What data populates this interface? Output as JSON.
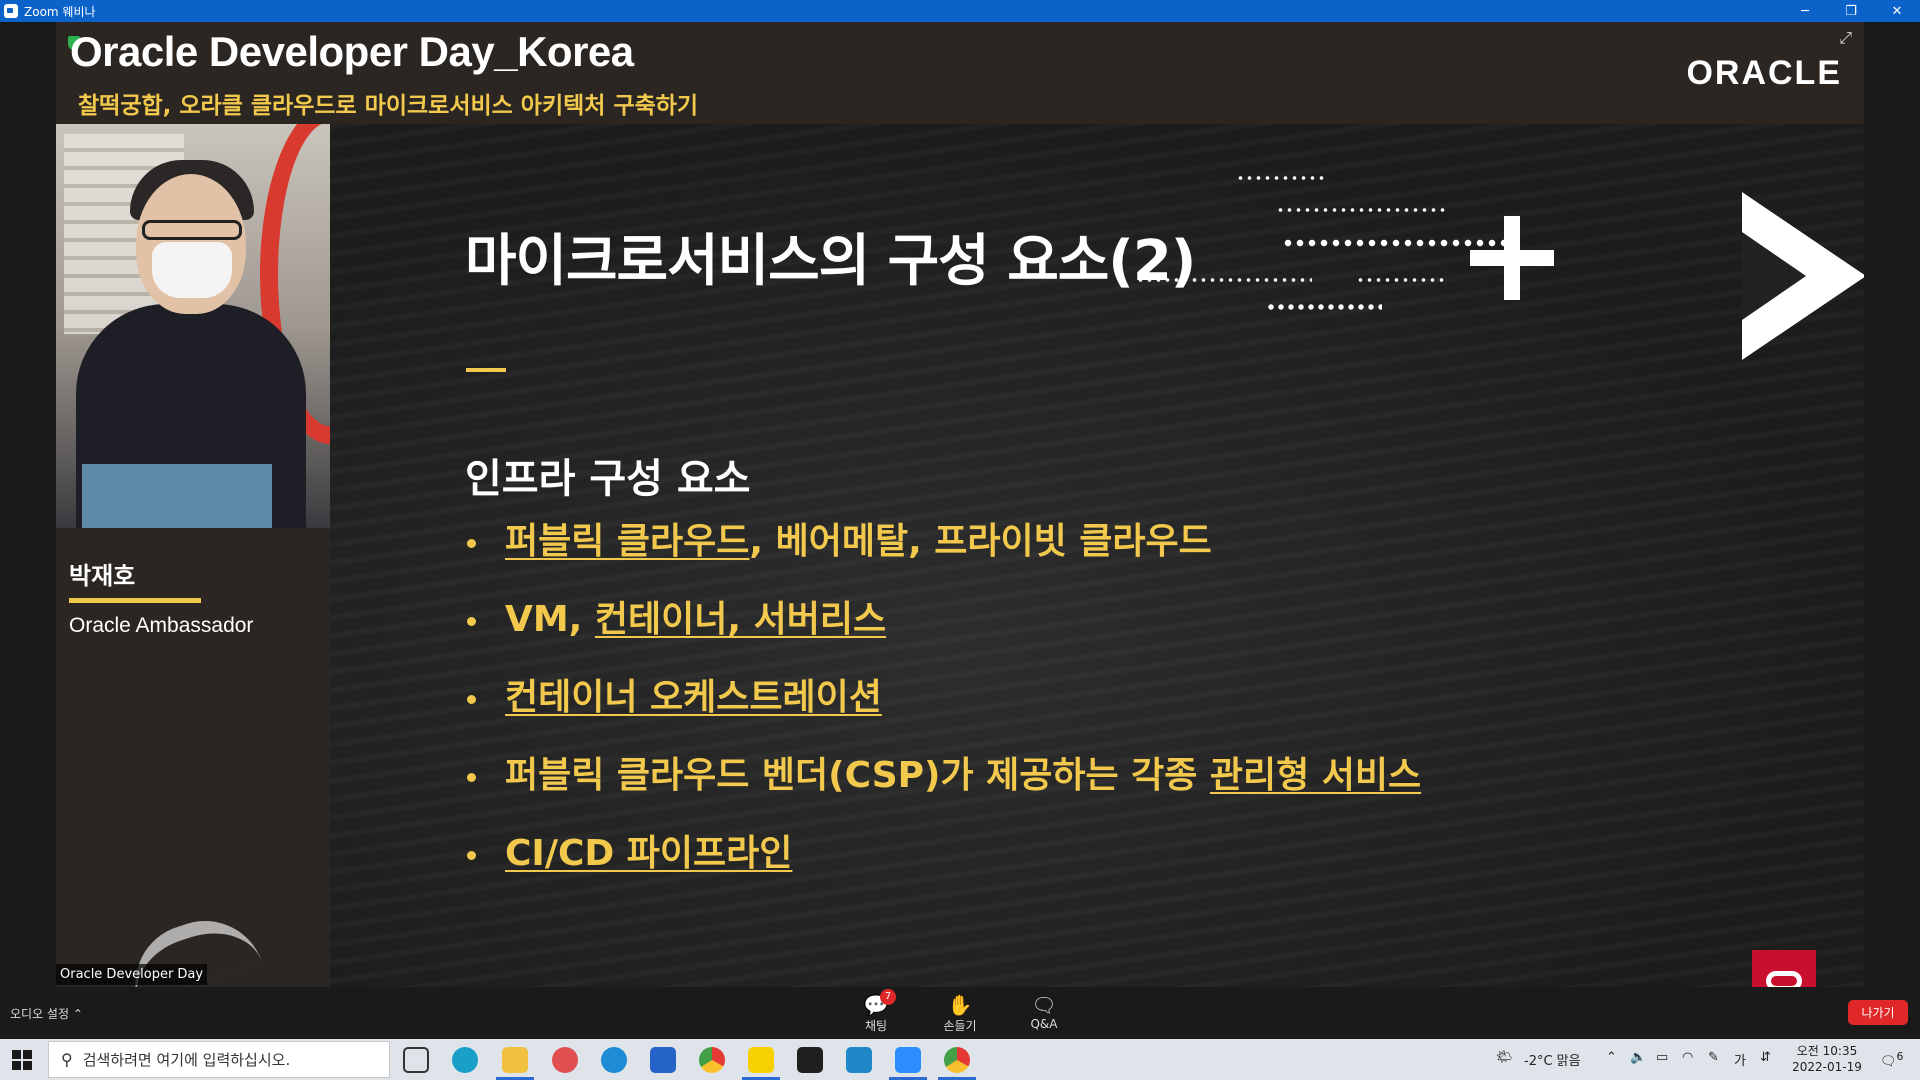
{
  "window": {
    "title": "Zoom 웨비나",
    "controls": {
      "minimize": "─",
      "restore": "❐",
      "close": "✕"
    }
  },
  "header": {
    "event_title": "Oracle Developer Day_Korea",
    "event_subtitle": "찰떡궁합, 오라클 클라우드로 마이크로서비스 아키텍처 구축하기",
    "logo": "ORACLE"
  },
  "speaker": {
    "name": "박재호",
    "role": "Oracle Ambassador",
    "video_label": "Oracle Developer Day"
  },
  "slide": {
    "title": "마이크로서비스의 구성 요소(2)",
    "section": "인프라 구성 요소",
    "bullets": [
      {
        "parts": [
          {
            "text": "퍼블릭 클라우드",
            "underline": true
          },
          {
            "text": ", 베어메탈, 프라이빗 클라우드",
            "underline": false
          }
        ]
      },
      {
        "parts": [
          {
            "text": "VM, ",
            "underline": false
          },
          {
            "text": "컨테이너, 서버리스",
            "underline": true
          }
        ]
      },
      {
        "parts": [
          {
            "text": "컨테이너 오케스트레이션",
            "underline": true
          }
        ]
      },
      {
        "parts": [
          {
            "text": "퍼블릭 클라우드 벤더(CSP)가 제공하는 각종 ",
            "underline": false
          },
          {
            "text": "관리형 서비스",
            "underline": true
          }
        ]
      },
      {
        "parts": [
          {
            "text": "CI/CD 파이프라인",
            "underline": true
          }
        ]
      }
    ],
    "accent_color": "#f2c94c"
  },
  "controls": {
    "audio_settings": "오디오 설정 ⌃",
    "chat": {
      "label": "채팅",
      "badge": "7"
    },
    "raise_hand": {
      "label": "손들기"
    },
    "qa": {
      "label": "Q&A"
    },
    "leave": "나가기"
  },
  "taskbar": {
    "search_placeholder": "검색하려면 여기에 입력하십시오.",
    "weather": "-2°C  맑음",
    "ime": "가",
    "time": "오전 10:35",
    "date": "2022-01-19",
    "notification_count": "6"
  }
}
